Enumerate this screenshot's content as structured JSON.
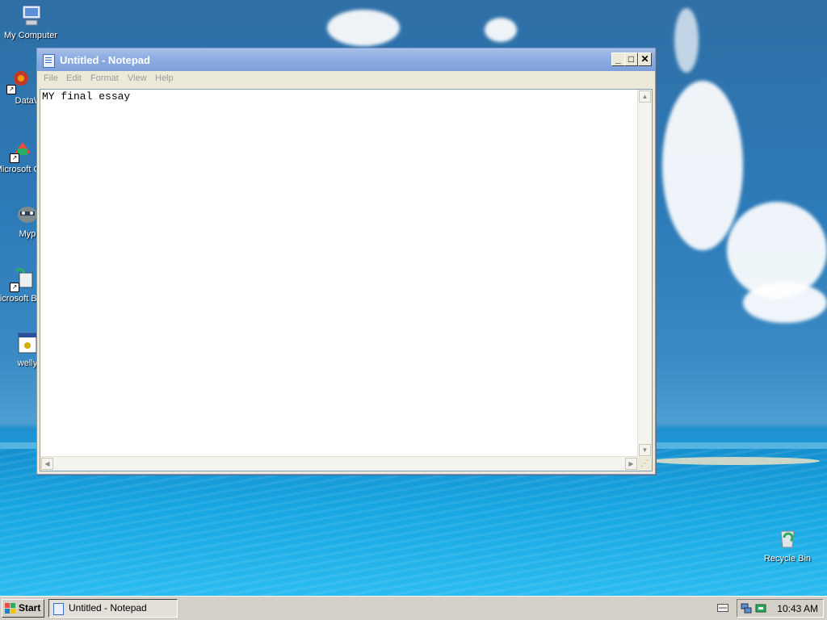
{
  "desktop": {
    "icons": [
      {
        "label": "My Computer"
      },
      {
        "label": "DataWa"
      },
      {
        "label": "Microsoft C++"
      },
      {
        "label": "Myp"
      },
      {
        "label": "Microsoft Basic"
      },
      {
        "label": "welly"
      }
    ],
    "recycle_bin": {
      "label": "Recycle Bin"
    }
  },
  "window": {
    "title": "Untitled - Notepad",
    "controls": {
      "minimize": "_",
      "maximize": "□",
      "close": "✕"
    },
    "menu": [
      "File",
      "Edit",
      "Format",
      "View",
      "Help"
    ],
    "content": "MY final essay"
  },
  "taskbar": {
    "start_label": "Start",
    "tasks": [
      {
        "label": "Untitled - Notepad"
      }
    ],
    "clock": "10:43 AM"
  },
  "colors": {
    "title_gradient": "#8eaee3",
    "taskbar": "#d4d0c8"
  }
}
